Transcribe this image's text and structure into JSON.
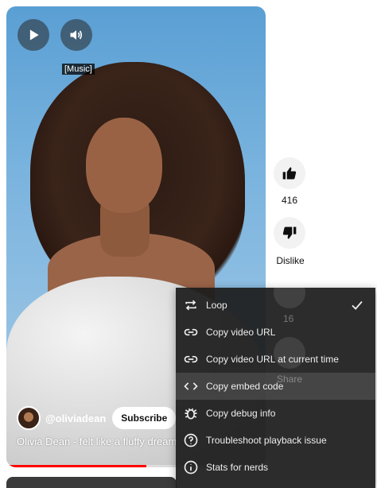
{
  "player": {
    "caption": "[Music]",
    "channel_handle": "@oliviadean",
    "subscribe_label": "Subscribe",
    "video_title": "Olivia Dean - felt like a fluffy dream !!!",
    "progress": 0.54
  },
  "actions": {
    "like_count": "416",
    "dislike_label": "Dislike",
    "comments_count": "16",
    "share_label": "Share"
  },
  "menu": {
    "items": [
      {
        "label": "Loop",
        "icon": "loop-icon",
        "checked": true
      },
      {
        "label": "Copy video URL",
        "icon": "link-icon"
      },
      {
        "label": "Copy video URL at current time",
        "icon": "link-icon"
      },
      {
        "label": "Copy embed code",
        "icon": "code-icon"
      },
      {
        "label": "Copy debug info",
        "icon": "bug-icon"
      },
      {
        "label": "Troubleshoot playback issue",
        "icon": "help-icon"
      },
      {
        "label": "Stats for nerds",
        "icon": "info-icon"
      }
    ]
  },
  "colors": {
    "progress": "#ff0000",
    "menu_bg": "#1c1c1c",
    "action_bg": "#f2f2f2"
  }
}
